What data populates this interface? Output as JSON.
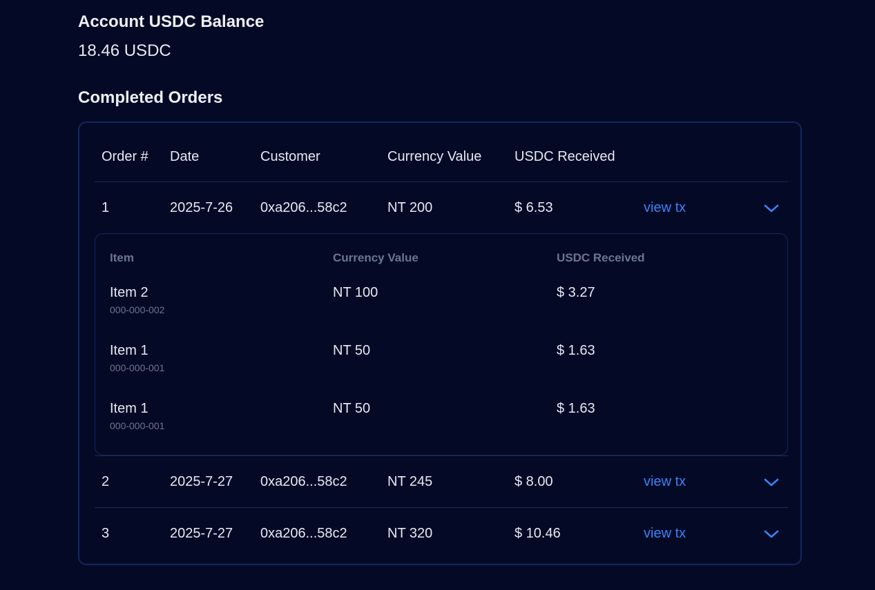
{
  "balance": {
    "title": "Account USDC Balance",
    "value": "18.46 USDC"
  },
  "orders": {
    "title": "Completed Orders",
    "columns": [
      "Order #",
      "Date",
      "Customer",
      "Currency Value",
      "USDC Received"
    ],
    "rows": [
      {
        "order": "1",
        "date": "2025-7-26",
        "customer": "0xa206...58c2",
        "currency": "NT 200",
        "usdc": "$ 6.53",
        "tx_label": "view tx",
        "expanded": true
      },
      {
        "order": "2",
        "date": "2025-7-27",
        "customer": "0xa206...58c2",
        "currency": "NT 245",
        "usdc": "$ 8.00",
        "tx_label": "view tx",
        "expanded": false
      },
      {
        "order": "3",
        "date": "2025-7-27",
        "customer": "0xa206...58c2",
        "currency": "NT 320",
        "usdc": "$ 10.46",
        "tx_label": "view tx",
        "expanded": false
      }
    ],
    "detail": {
      "columns": [
        "Item",
        "Currency Value",
        "USDC Received"
      ],
      "items": [
        {
          "name": "Item 2",
          "sku": "000-000-002",
          "currency": "NT 100",
          "usdc": "$ 3.27"
        },
        {
          "name": "Item 1",
          "sku": "000-000-001",
          "currency": "NT 50",
          "usdc": "$ 1.63"
        },
        {
          "name": "Item 1",
          "sku": "000-000-001",
          "currency": "NT 50",
          "usdc": "$ 1.63"
        }
      ]
    }
  },
  "colors": {
    "background": "#040a26",
    "accent": "#3b82f6",
    "border": "#13265e",
    "muted": "#6b7591"
  },
  "icons": {
    "expand": "chevron-down-icon"
  }
}
